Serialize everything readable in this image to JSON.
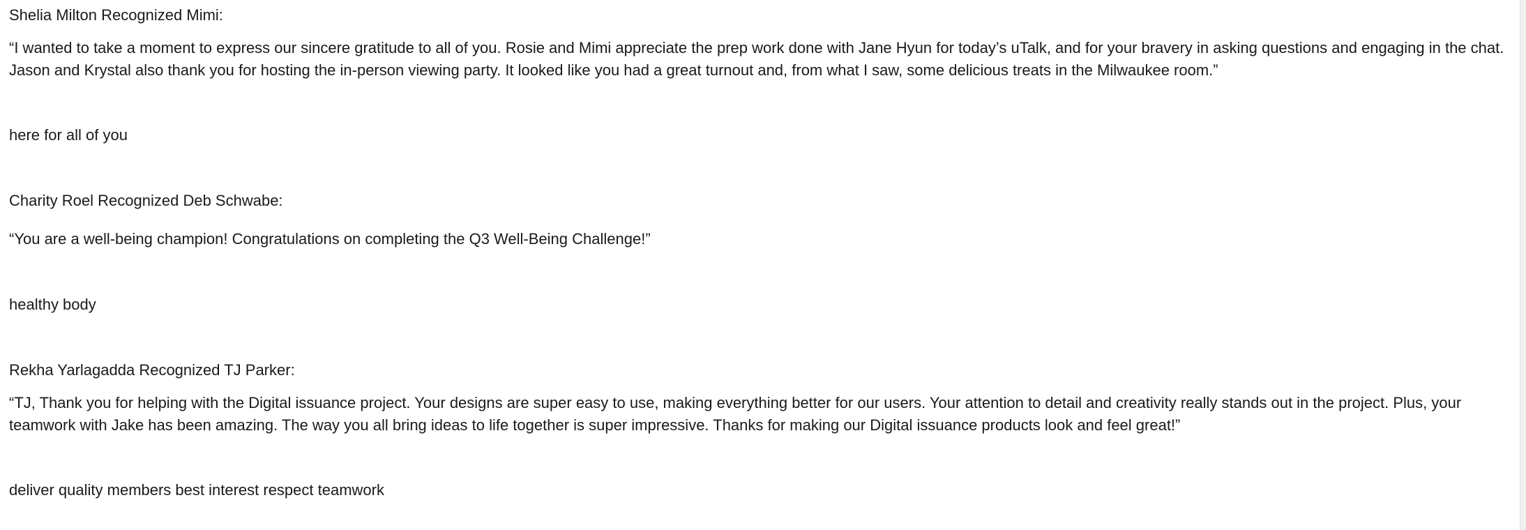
{
  "recognitions": [
    {
      "header": "Shelia Milton Recognized Mimi:",
      "quote": "“I wanted to take a moment to express our sincere gratitude to all of you. Rosie and Mimi appreciate the prep work done with Jane Hyun for today’s uTalk, and for your bravery in asking questions and engaging in the chat. Jason and Krystal also thank you for hosting the in-person viewing party. It looked like you had a great turnout and, from what I saw, some delicious treats in the Milwaukee room.”",
      "values": "here for all of you"
    },
    {
      "header": "Charity Roel Recognized Deb Schwabe:",
      "quote": "“You are a well-being champion! Congratulations on completing the Q3 Well-Being Challenge!”",
      "values": "healthy body"
    },
    {
      "header": "Rekha Yarlagadda Recognized TJ Parker:",
      "quote": "“TJ, Thank you for helping with the Digital issuance project. Your designs are super easy to use, making everything better for our users. Your attention to detail and creativity really stands out in the project. Plus, your teamwork with Jake has been amazing. The way you all bring ideas to life together is super impressive. Thanks for making our Digital issuance products look and feel great!”",
      "values": "deliver quality members best interest respect teamwork"
    }
  ]
}
